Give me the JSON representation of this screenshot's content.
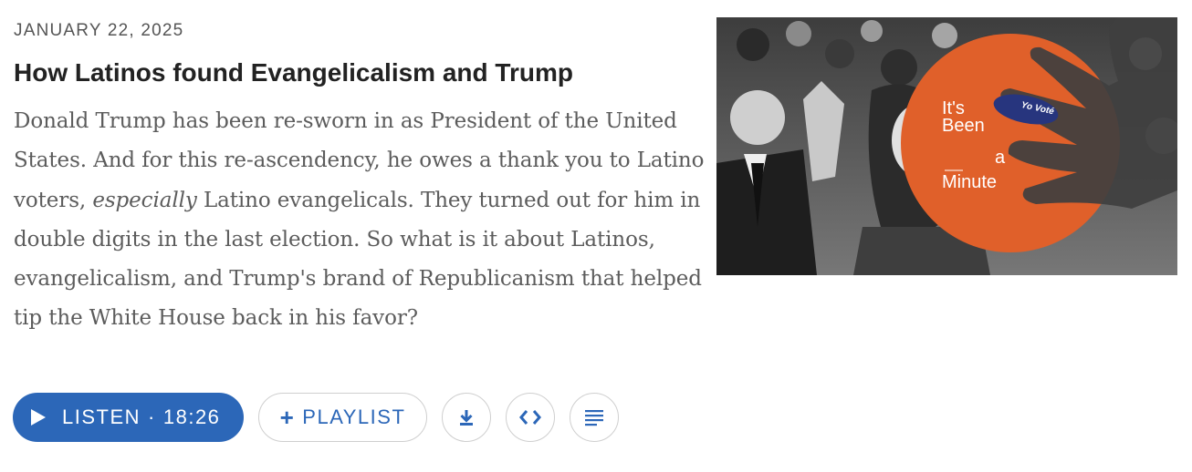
{
  "story": {
    "date": "JANUARY 22, 2025",
    "title": "How Latinos found Evangelicalism and Trump",
    "teaser_before_em": "Donald Trump has been re-sworn in as President of the United States. And for this re-ascendency, he owes a thank you to Latino voters, ",
    "teaser_em": "especially",
    "teaser_after_em": " Latino evangelicals. They turned out for him in double digits in the last election. So what is it about Latinos, evangelicalism, and Trump's brand of Republicanism that helped tip the White House back in his favor?"
  },
  "actions": {
    "listen_label": "LISTEN",
    "listen_separator": "·",
    "duration": "18:26",
    "playlist_label": "PLAYLIST",
    "icons": [
      "play-icon",
      "plus-icon",
      "download-icon",
      "embed-icon",
      "transcript-icon"
    ]
  },
  "thumbnail": {
    "logo_line1": "It's",
    "logo_line2": "Been",
    "logo_line3": "a",
    "logo_line4": "Minute",
    "sticker_text": "Yo Voté"
  },
  "colors": {
    "accent_blue": "#2c67b8",
    "logo_orange": "#e0602a",
    "date_gray": "#555555",
    "title_dark": "#222222",
    "teaser_gray": "#5c5c5c",
    "border_gray": "#cfcfcf"
  }
}
